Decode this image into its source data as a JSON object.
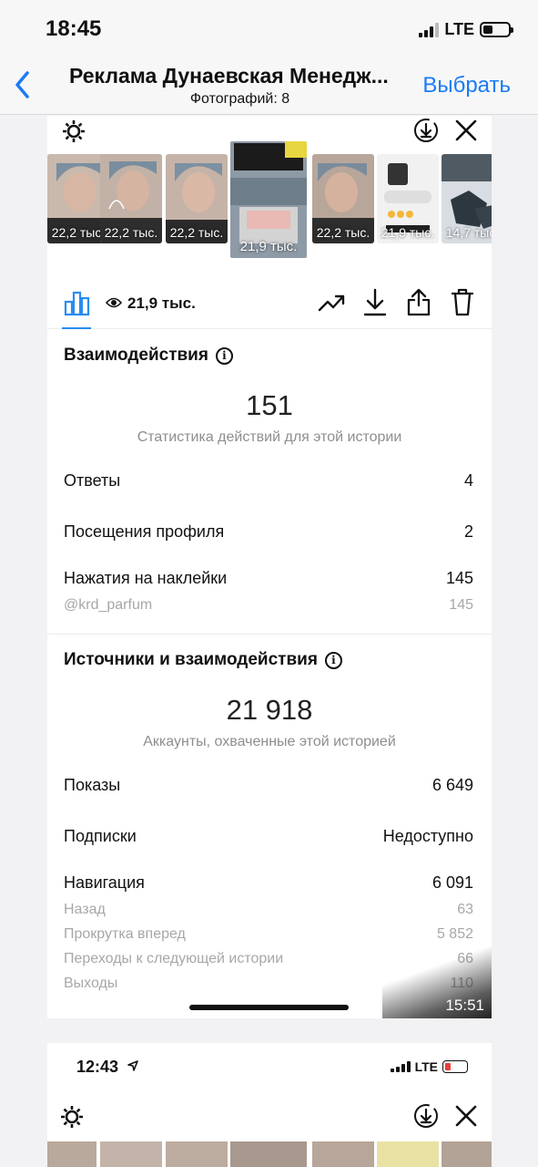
{
  "status_bar": {
    "time": "18:45",
    "network": "LTE"
  },
  "nav": {
    "title": "Реклама Дунаевская Менедж...",
    "subtitle": "Фотографий: 8",
    "select_label": "Выбрать"
  },
  "thumbnails": [
    {
      "views": "22,2 тыс."
    },
    {
      "views": "22,2 тыс."
    },
    {
      "views": "22,2 тыс."
    },
    {
      "views": "21,9 тыс.",
      "active": true
    },
    {
      "views": "22,2 тыс."
    },
    {
      "views": "21,9 тыс."
    },
    {
      "views": "14,7 тыс."
    }
  ],
  "toolbar": {
    "reach": "21,9 тыс."
  },
  "interactions": {
    "title": "Взаимодействия",
    "total": "151",
    "caption": "Статистика действий для этой истории",
    "rows": [
      {
        "label": "Ответы",
        "value": "4"
      },
      {
        "label": "Посещения профиля",
        "value": "2"
      },
      {
        "label": "Нажатия на наклейки",
        "value": "145"
      }
    ],
    "sticker": {
      "label": "@krd_parfum",
      "value": "145"
    }
  },
  "sources": {
    "title": "Источники и взаимодействия",
    "total": "21 918",
    "caption": "Аккаунты, охваченные этой историей",
    "rows": [
      {
        "label": "Показы",
        "value": "6 649"
      },
      {
        "label": "Подписки",
        "value": "Недоступно"
      },
      {
        "label": "Навигация",
        "value": "6 091"
      }
    ],
    "nav_rows": [
      {
        "label": "Назад",
        "value": "63"
      },
      {
        "label": "Прокрутка вперед",
        "value": "5 852"
      },
      {
        "label": "Переходы к следующей истории",
        "value": "66"
      },
      {
        "label": "Выходы",
        "value": "110"
      }
    ]
  },
  "video_time": "15:51",
  "second_screenshot": {
    "time": "12:43",
    "network": "LTE"
  },
  "colors": {
    "accent": "#1a7cf5",
    "tab_underline": "#2a8cf0",
    "muted": "#8e8e8e",
    "battery_low": "#e8403a"
  }
}
